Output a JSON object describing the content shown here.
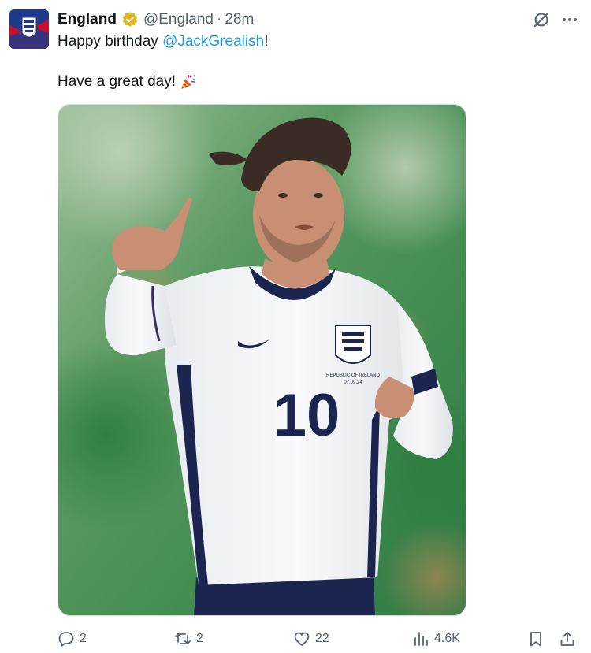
{
  "author": {
    "name": "England",
    "handle": "@England",
    "separator": "·",
    "time": "28m"
  },
  "tweet": {
    "line1_prefix": "Happy birthday ",
    "line1_mention": "@JackGrealish",
    "line1_suffix": "!",
    "line2": "Have a great day!"
  },
  "media": {
    "shirt_number": "10",
    "crest_caption_1": "REPUBLIC OF IRELAND",
    "crest_caption_2": "07.09.24"
  },
  "actions": {
    "replies": "2",
    "reposts": "2",
    "likes": "22",
    "views": "4.6K"
  },
  "icons": {
    "verified": "verified-badge-icon",
    "grok": "grok-icon",
    "more": "more-icon",
    "reply": "reply-icon",
    "repost": "repost-icon",
    "like": "like-icon",
    "views": "views-icon",
    "bookmark": "bookmark-icon",
    "share": "share-icon",
    "party": "party-popper-icon"
  },
  "colors": {
    "text": "#0f1419",
    "secondary": "#536471",
    "mention": "#1d9bf0",
    "verified_gold": "#e2b719"
  }
}
